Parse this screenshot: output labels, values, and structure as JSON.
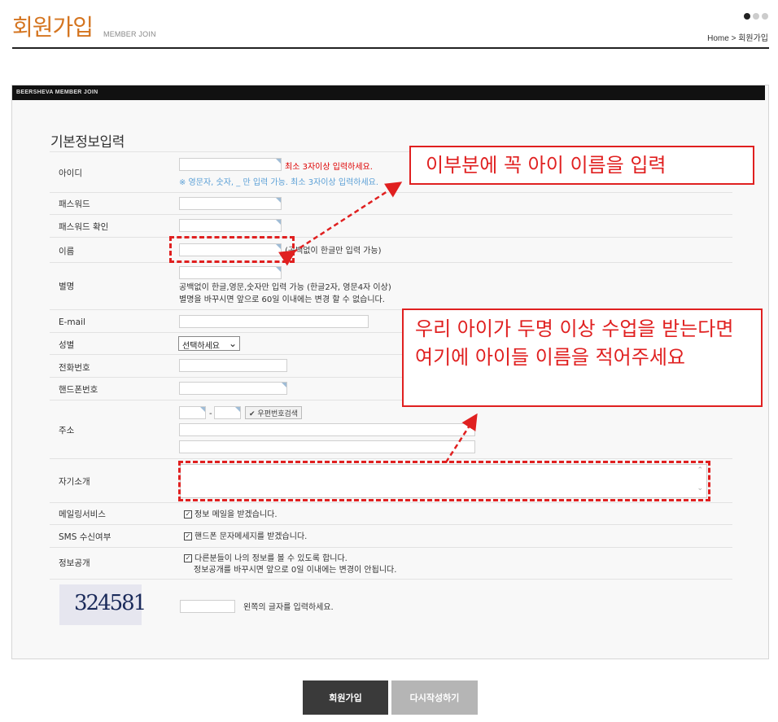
{
  "header": {
    "title": "회원가입",
    "subtitle": "MEMBER JOIN",
    "breadcrumb": "Home > 회원가입"
  },
  "form": {
    "bar_title": "BEERSHEVA MEMBER JOIN",
    "section_title": "기본정보입력",
    "labels": {
      "id": "아이디",
      "password": "패스워드",
      "password_confirm": "패스워드 확인",
      "name": "이름",
      "nickname": "별명",
      "email": "E-mail",
      "gender": "성별",
      "phone": "전화번호",
      "mobile": "핸드폰번호",
      "address": "주소",
      "intro": "자기소개",
      "mailing": "메일링서비스",
      "sms": "SMS 수신여부",
      "public_info": "정보공개"
    },
    "hints": {
      "id_red": "최소 3자이상 입력하세요.",
      "id_blue": "※ 영문자, 숫자, _ 만 입력 가능. 최소 3자이상 입력하세요.",
      "name": "(공백없이 한글만 입력 가능)",
      "nickname_1": "공백없이 한글,영문,숫자만 입력 가능 (한글2자, 영문4자 이상)",
      "nickname_2": "별명을 바꾸시면 앞으로 60일 이내에는 변경 할 수 없습니다.",
      "zip_sep": "-",
      "zip_button": "우편번호검색",
      "mailing": "정보 메일을 받겠습니다.",
      "sms": "핸드폰 문자메세지를 받겠습니다.",
      "public_1": "다른분들이 나의 정보를 볼 수 있도록 합니다.",
      "public_2": "정보공개를 바꾸시면 앞으로 0일 이내에는 변경이 안됩니다.",
      "captcha": "왼쪽의 글자를 입력하세요."
    },
    "gender_select": "선택하세요",
    "captcha_code": "324581",
    "checkboxes": {
      "mailing": true,
      "sms": true,
      "public": true
    }
  },
  "buttons": {
    "submit": "회원가입",
    "reset": "다시작성하기"
  },
  "annotations": {
    "note1": "이부분에 꼭 아이 이름을 입력",
    "note2": "우리 아이가 두명 이상 수업을 받는다면 여기에 아이들 이름을 적어주세요",
    "color": "#e02020"
  },
  "colors": {
    "accent": "#d4741f",
    "hint_red": "#dd0000",
    "hint_blue": "#5a9fd6"
  }
}
